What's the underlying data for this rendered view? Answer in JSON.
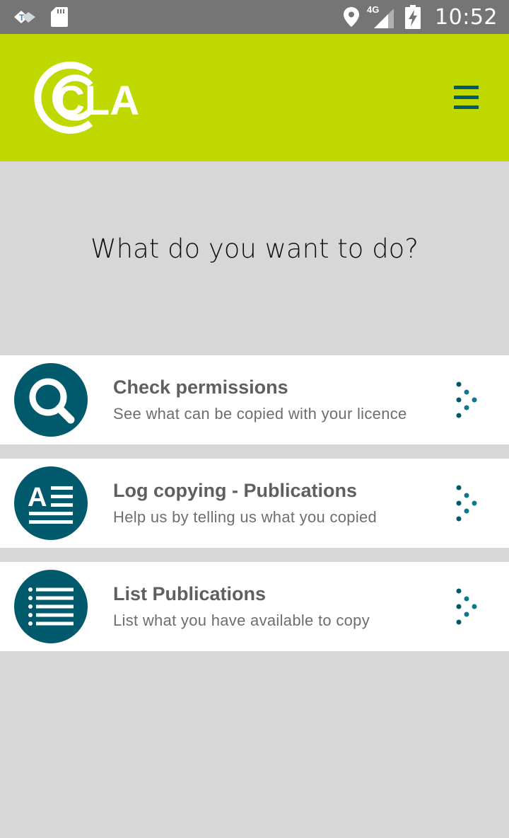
{
  "status_bar": {
    "time": "10:52",
    "network": "4G",
    "icons": [
      "app-notification-icon",
      "sd-card-icon",
      "location-icon",
      "signal-icon",
      "battery-charging-icon"
    ]
  },
  "app_bar": {
    "logo_text": "CLA",
    "menu_icon": "hamburger-menu-icon",
    "colors": {
      "background": "#bfd900",
      "logo": "#ffffff",
      "menu": "#005a6b"
    }
  },
  "main": {
    "heading": "What do you want to do?",
    "actions": [
      {
        "title": "Check permissions",
        "subtitle": "See what can be copied with your licence",
        "icon": "magnifier-icon"
      },
      {
        "title": "Log copying - Publications",
        "subtitle": "Help us by telling us what you copied",
        "icon": "log-document-icon"
      },
      {
        "title": "List Publications",
        "subtitle": "List what you have available to copy",
        "icon": "list-icon"
      }
    ],
    "chevron_icon": "dotted-chevron-icon",
    "accent_color": "#005a6b"
  }
}
